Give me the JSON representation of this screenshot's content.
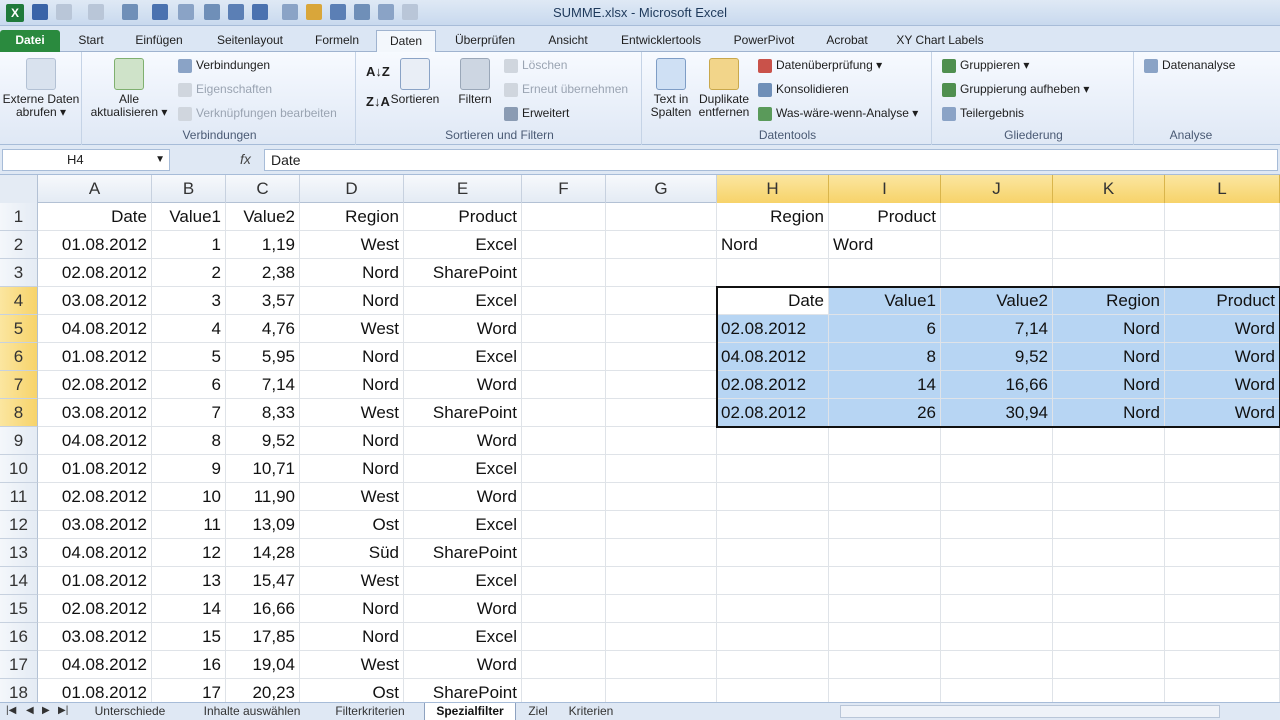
{
  "window": {
    "title": "SUMME.xlsx - Microsoft Excel",
    "logo": "X"
  },
  "tabs": [
    "Datei",
    "Start",
    "Einfügen",
    "Seitenlayout",
    "Formeln",
    "Daten",
    "Überprüfen",
    "Ansicht",
    "Entwicklertools",
    "PowerPivot",
    "Acrobat",
    "XY Chart Labels"
  ],
  "ribbon": {
    "external": {
      "label1": "Externe Daten",
      "label2": "abrufen"
    },
    "verbindungen": {
      "all1": "Alle",
      "all2": "aktualisieren",
      "conn": "Verbindungen",
      "props": "Eigenschaften",
      "links": "Verknüpfungen bearbeiten",
      "group": "Verbindungen"
    },
    "sort": {
      "sort": "Sortieren",
      "filter": "Filtern",
      "clear": "Löschen",
      "reapply": "Erneut übernehmen",
      "advanced": "Erweitert",
      "group": "Sortieren und Filtern"
    },
    "tools": {
      "text1": "Text in",
      "text2": "Spalten",
      "dup1": "Duplikate",
      "dup2": "entfernen",
      "valid": "Datenüberprüfung",
      "consol": "Konsolidieren",
      "whatif": "Was-wäre-wenn-Analyse",
      "group": "Datentools"
    },
    "outline": {
      "group_btn": "Gruppieren",
      "ungroup": "Gruppierung aufheben",
      "subtotal": "Teilergebnis",
      "group": "Gliederung"
    },
    "analysis": {
      "btn": "Datenanalyse",
      "group": "Analyse"
    }
  },
  "formula_bar": {
    "namebox": "H4",
    "fx": "fx",
    "content": "Date"
  },
  "columns": [
    "A",
    "B",
    "C",
    "D",
    "E",
    "F",
    "G",
    "H",
    "I",
    "J",
    "K",
    "L"
  ],
  "rows": [
    "1",
    "2",
    "3",
    "4",
    "5",
    "6",
    "7",
    "8",
    "9",
    "10",
    "11",
    "12",
    "13",
    "14",
    "15",
    "16",
    "17",
    "18"
  ],
  "source_table": {
    "headers": [
      "Date",
      "Value1",
      "Value2",
      "Region",
      "Product"
    ],
    "rows": [
      [
        "01.08.2012",
        "1",
        "1,19",
        "West",
        "Excel"
      ],
      [
        "02.08.2012",
        "2",
        "2,38",
        "Nord",
        "SharePoint"
      ],
      [
        "03.08.2012",
        "3",
        "3,57",
        "Nord",
        "Excel"
      ],
      [
        "04.08.2012",
        "4",
        "4,76",
        "West",
        "Word"
      ],
      [
        "01.08.2012",
        "5",
        "5,95",
        "Nord",
        "Excel"
      ],
      [
        "02.08.2012",
        "6",
        "7,14",
        "Nord",
        "Word"
      ],
      [
        "03.08.2012",
        "7",
        "8,33",
        "West",
        "SharePoint"
      ],
      [
        "04.08.2012",
        "8",
        "9,52",
        "Nord",
        "Word"
      ],
      [
        "01.08.2012",
        "9",
        "10,71",
        "Nord",
        "Excel"
      ],
      [
        "02.08.2012",
        "10",
        "11,90",
        "West",
        "Word"
      ],
      [
        "03.08.2012",
        "11",
        "13,09",
        "Ost",
        "Excel"
      ],
      [
        "04.08.2012",
        "12",
        "14,28",
        "Süd",
        "SharePoint"
      ],
      [
        "01.08.2012",
        "13",
        "15,47",
        "West",
        "Excel"
      ],
      [
        "02.08.2012",
        "14",
        "16,66",
        "Nord",
        "Word"
      ],
      [
        "03.08.2012",
        "15",
        "17,85",
        "Nord",
        "Excel"
      ],
      [
        "04.08.2012",
        "16",
        "19,04",
        "West",
        "Word"
      ],
      [
        "01.08.2012",
        "17",
        "20,23",
        "Ost",
        "SharePoint"
      ]
    ]
  },
  "criteria": {
    "headers": [
      "Region",
      "Product"
    ],
    "values": [
      "Nord",
      "Word"
    ]
  },
  "result_table": {
    "headers": [
      "Date",
      "Value1",
      "Value2",
      "Region",
      "Product"
    ],
    "rows": [
      [
        "02.08.2012",
        "6",
        "7,14",
        "Nord",
        "Word"
      ],
      [
        "04.08.2012",
        "8",
        "9,52",
        "Nord",
        "Word"
      ],
      [
        "02.08.2012",
        "14",
        "16,66",
        "Nord",
        "Word"
      ],
      [
        "02.08.2012",
        "26",
        "30,94",
        "Nord",
        "Word"
      ]
    ]
  },
  "sheet_tabs": [
    "Unterschiede",
    "Inhalte auswählen",
    "Filterkriterien",
    "Spezialfilter",
    "Ziel",
    "Kriterien"
  ],
  "active_sheet": "Spezialfilter",
  "colors": {
    "selection_fill": "#b7d5f3",
    "header_selected": "#f7d36a",
    "file_tab": "#2a8a3e"
  }
}
